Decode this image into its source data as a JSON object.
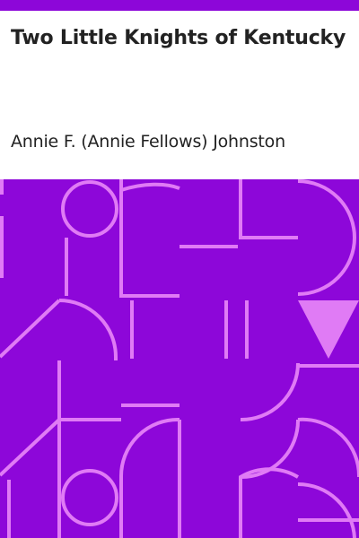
{
  "book": {
    "title": "Two Little Knights of Kentucky",
    "author": "Annie F. (Annie Fellows) Johnston"
  },
  "colors": {
    "accent": "#8d07d9",
    "pattern": "#e07bf5",
    "text": "#222222",
    "background": "#ffffff"
  }
}
